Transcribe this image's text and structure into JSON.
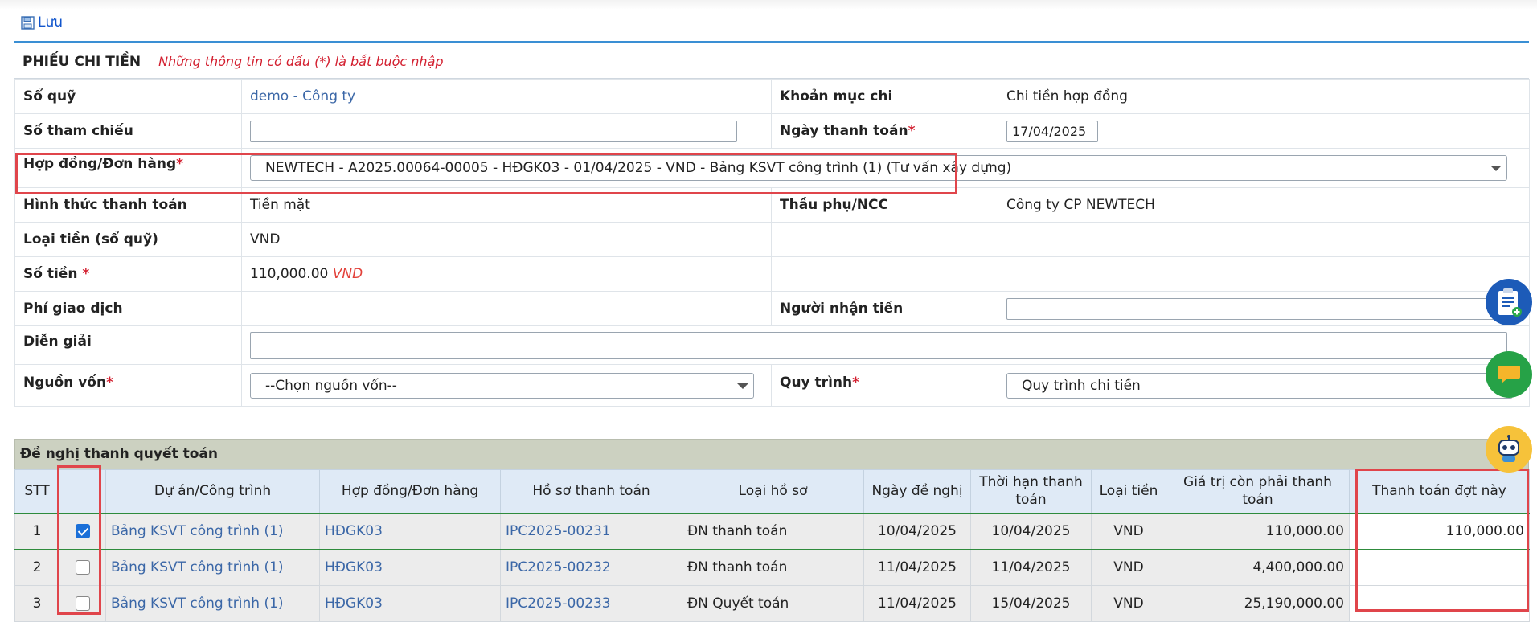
{
  "toolbar": {
    "save_label": "Lưu"
  },
  "form": {
    "title": "PHIẾU CHI TIỀN",
    "required_note": "Những thông tin có dấu (*) là bắt buộc nhập",
    "so_quy": {
      "label": "Sổ quỹ",
      "value": "demo - Công ty"
    },
    "khoan_muc_chi": {
      "label": "Khoản mục chi",
      "value": "Chi tiền hợp đồng"
    },
    "so_tham_chieu": {
      "label": "Số tham chiếu",
      "value": ""
    },
    "ngay_thanh_toan": {
      "label": "Ngày thanh toán",
      "value": "17/04/2025"
    },
    "hop_dong": {
      "label": "Hợp đồng/Đơn hàng",
      "value": "NEWTECH - A2025.00064-00005 - HĐGK03 - 01/04/2025 - VND - Bảng KSVT công trình (1) (Tư vấn xây dựng)"
    },
    "hinh_thuc": {
      "label": "Hình thức thanh toán",
      "value": "Tiền mặt"
    },
    "thau_phu": {
      "label": "Thầu phụ/NCC",
      "value": "Công ty CP NEWTECH"
    },
    "loai_tien": {
      "label": "Loại tiền (sổ quỹ)",
      "value": "VND"
    },
    "so_tien": {
      "label": "Số tiền",
      "value": "110,000.00",
      "currency": "VND"
    },
    "phi_giao_dich": {
      "label": "Phí giao dịch",
      "value": ""
    },
    "nguoi_nhan": {
      "label": "Người nhận tiền",
      "value": ""
    },
    "dien_giai": {
      "label": "Diễn giải",
      "value": ""
    },
    "nguon_von": {
      "label": "Nguồn vốn",
      "value": "--Chọn nguồn vốn--"
    },
    "quy_trinh": {
      "label": "Quy trình",
      "value": "Quy trình chi tiền"
    },
    "asterisk": "*"
  },
  "section": {
    "title": "Đề nghị thanh quyết toán",
    "columns": [
      "STT",
      "",
      "Dự án/Công trình",
      "Hợp đồng/Đơn hàng",
      "Hồ sơ thanh toán",
      "Loại hồ sơ",
      "Ngày đề nghị",
      "Thời hạn thanh toán",
      "Loại tiền",
      "Giá trị còn phải thanh toán",
      "Thanh toán đợt này"
    ],
    "rows": [
      {
        "stt": "1",
        "checked": true,
        "du_an": "Bảng KSVT công trình (1)",
        "hop_dong": "HĐGK03",
        "ho_so": "IPC2025-00231",
        "loai": "ĐN thanh toán",
        "ngay": "10/04/2025",
        "han": "10/04/2025",
        "tien": "VND",
        "con_lai": "110,000.00",
        "dot_nay": "110,000.00"
      },
      {
        "stt": "2",
        "checked": false,
        "du_an": "Bảng KSVT công trình (1)",
        "hop_dong": "HĐGK03",
        "ho_so": "IPC2025-00232",
        "loai": "ĐN thanh toán",
        "ngay": "11/04/2025",
        "han": "11/04/2025",
        "tien": "VND",
        "con_lai": "4,400,000.00",
        "dot_nay": ""
      },
      {
        "stt": "3",
        "checked": false,
        "du_an": "Bảng KSVT công trình (1)",
        "hop_dong": "HĐGK03",
        "ho_so": "IPC2025-00233",
        "loai": "ĐN Quyết toán",
        "ngay": "11/04/2025",
        "han": "15/04/2025",
        "tien": "VND",
        "con_lai": "25,190,000.00",
        "dot_nay": ""
      }
    ]
  },
  "colors": {
    "accent": "#3a8fd4",
    "required": "#d32030",
    "link": "#3b67a7",
    "highlight": "#e0454b",
    "section_bg": "#ccd1c1",
    "header_bg": "#dfeaf6"
  },
  "icons": [
    "save-icon",
    "clipboard-add-icon",
    "chat-icon",
    "robot-icon"
  ]
}
